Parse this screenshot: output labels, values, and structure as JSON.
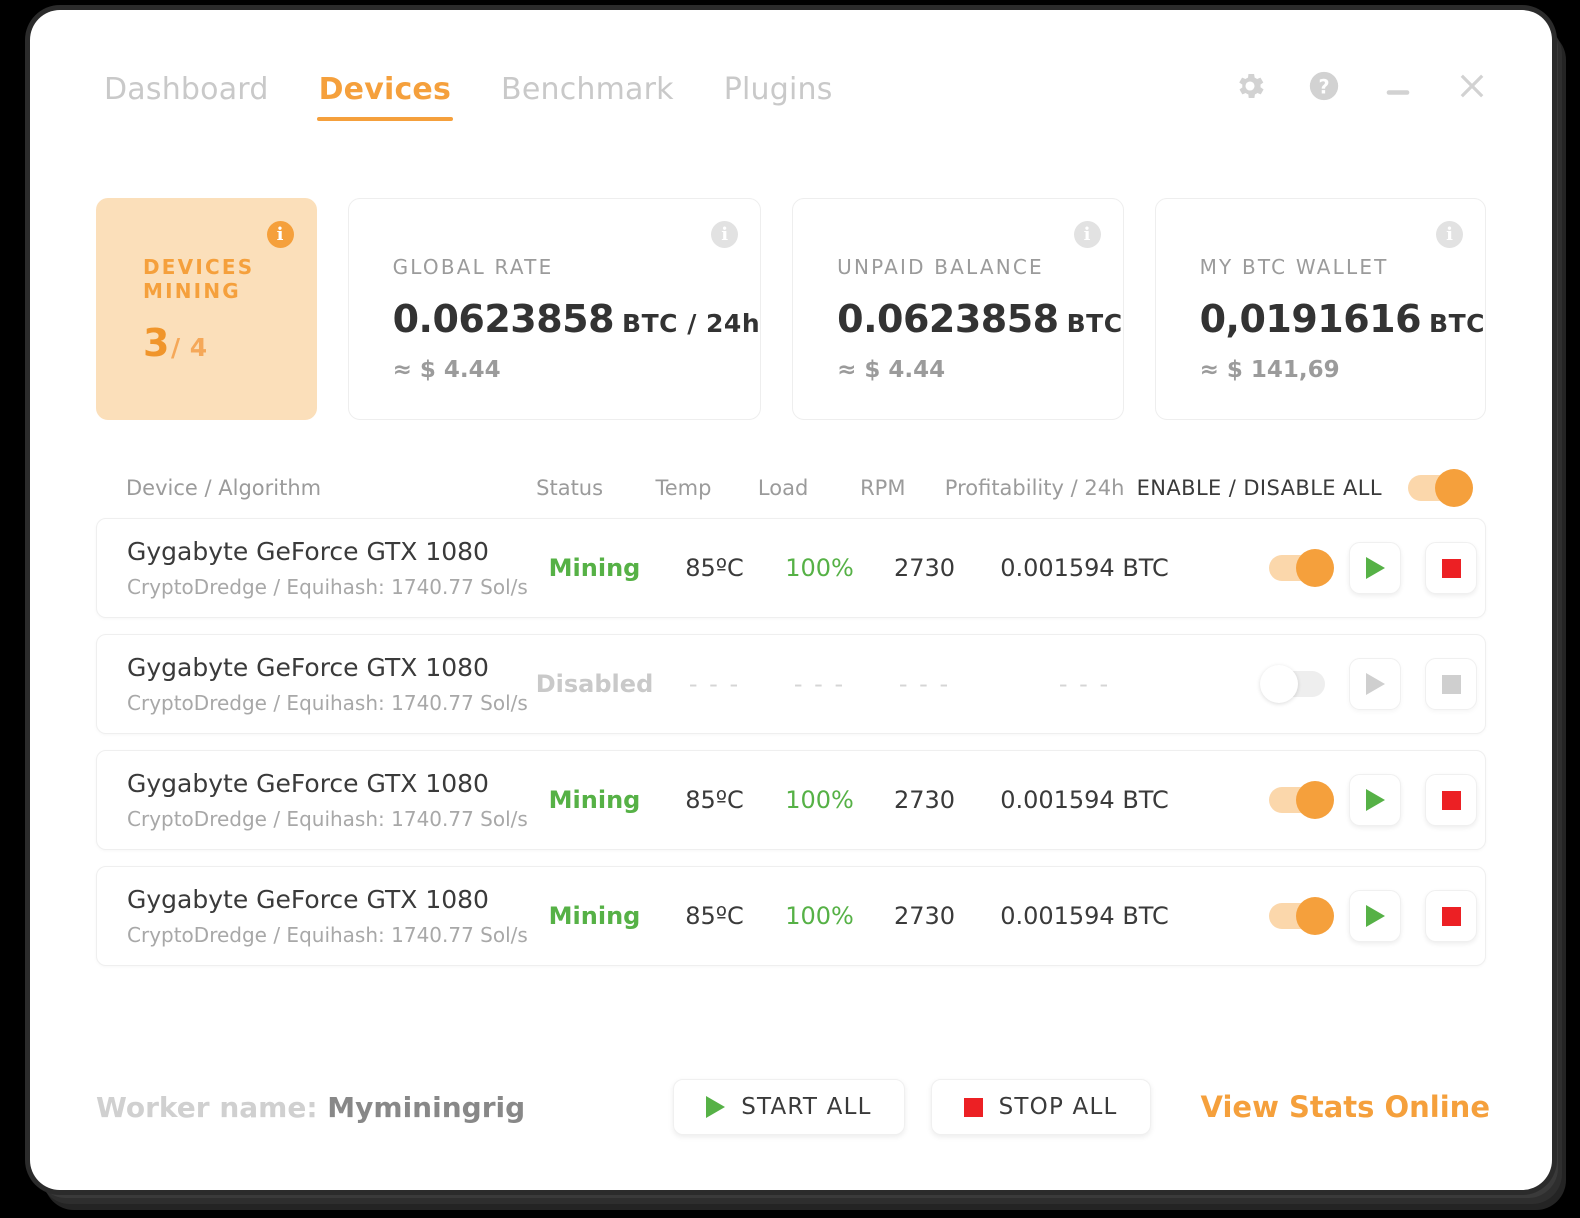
{
  "window": {
    "tabs": [
      {
        "label": "Dashboard",
        "active": false
      },
      {
        "label": "Devices",
        "active": true
      },
      {
        "label": "Benchmark",
        "active": false
      },
      {
        "label": "Plugins",
        "active": false
      }
    ],
    "controls": [
      {
        "name": "settings-icon",
        "glyph": "gear"
      },
      {
        "name": "help-icon",
        "glyph": "question"
      },
      {
        "name": "minimize-icon",
        "glyph": "minus"
      },
      {
        "name": "close-icon",
        "glyph": "close"
      }
    ]
  },
  "colors": {
    "accent_orange": "#f5a03c",
    "card_highlight_bg": "#fbdfba",
    "green": "#56b146",
    "red": "#ec2024",
    "muted_gray": "#9b9b9b"
  },
  "cards": [
    {
      "label": "DEVICES MINING",
      "value": "3",
      "unit": "/ 4",
      "sub": "",
      "highlight": true,
      "info": "i"
    },
    {
      "label": "GLOBAL RATE",
      "value": "0.0623858",
      "unit": "BTC / 24h",
      "sub": "≈ $ 4.44",
      "highlight": false,
      "info": "i"
    },
    {
      "label": "UNPAID BALANCE",
      "value": "0.0623858",
      "unit": "BTC",
      "sub": "≈ $ 4.44",
      "highlight": false,
      "info": "i"
    },
    {
      "label": "MY BTC WALLET",
      "value": "0,0191616",
      "unit": "BTC",
      "sub": "≈ $ 141,69",
      "highlight": false,
      "info": "i"
    }
  ],
  "table": {
    "headers": {
      "device": "Device / Algorithm",
      "status": "Status",
      "temp": "Temp",
      "load": "Load",
      "rpm": "RPM",
      "profit": "Profitability / 24h",
      "enable_all": "ENABLE / DISABLE ALL"
    },
    "enable_all_on": true,
    "rows": [
      {
        "device": "Gygabyte GeForce GTX 1080",
        "algorithm": "CryptoDredge / Equihash: 1740.77 Sol/s",
        "status": "Mining",
        "temp": "85ºC",
        "load": "100%",
        "rpm": "2730",
        "profit": "0.001594 BTC",
        "enabled": true
      },
      {
        "device": "Gygabyte GeForce GTX 1080",
        "algorithm": "CryptoDredge / Equihash: 1740.77 Sol/s",
        "status": "Disabled",
        "temp": "- - -",
        "load": "- - -",
        "rpm": "- - -",
        "profit": "- - -",
        "enabled": false
      },
      {
        "device": "Gygabyte GeForce GTX 1080",
        "algorithm": "CryptoDredge / Equihash: 1740.77 Sol/s",
        "status": "Mining",
        "temp": "85ºC",
        "load": "100%",
        "rpm": "2730",
        "profit": "0.001594 BTC",
        "enabled": true
      },
      {
        "device": "Gygabyte GeForce GTX 1080",
        "algorithm": "CryptoDredge / Equihash: 1740.77 Sol/s",
        "status": "Mining",
        "temp": "85ºC",
        "load": "100%",
        "rpm": "2730",
        "profit": "0.001594 BTC",
        "enabled": true
      }
    ]
  },
  "footer": {
    "worker_label": "Worker name:",
    "worker_name": "Myminingrig",
    "start_all": "START ALL",
    "stop_all": "STOP ALL",
    "view_stats": "View Stats Online"
  }
}
